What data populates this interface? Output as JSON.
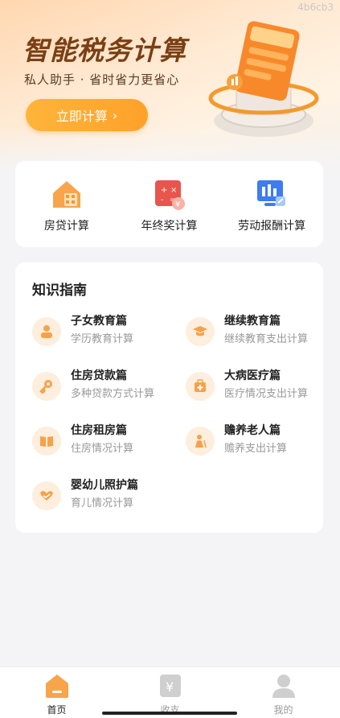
{
  "tag": "4b6cb3",
  "hero": {
    "title": "智能税务计算",
    "subtitle": "私人助手 · 省时省力更省心",
    "cta_label": "立即计算",
    "cta_arrow": "›"
  },
  "tools": [
    {
      "label": "房贷计算",
      "icon": "house-calculator-icon"
    },
    {
      "label": "年终奖计算",
      "icon": "bonus-calculator-icon"
    },
    {
      "label": "劳动报酬计算",
      "icon": "labor-pay-icon"
    }
  ],
  "guide": {
    "title": "知识指南",
    "items": [
      {
        "title": "子女教育篇",
        "sub": "学历教育计算",
        "icon": "person-icon"
      },
      {
        "title": "继续教育篇",
        "sub": "继续教育支出计算",
        "icon": "graduation-cap-icon"
      },
      {
        "title": "住房贷款篇",
        "sub": "多种贷款方式计算",
        "icon": "key-icon"
      },
      {
        "title": "大病医疗篇",
        "sub": "医疗情况支出计算",
        "icon": "medical-kit-icon"
      },
      {
        "title": "住房租房篇",
        "sub": "住房情况计算",
        "icon": "book-icon"
      },
      {
        "title": "赡养老人篇",
        "sub": "赡养支出计算",
        "icon": "elderly-icon"
      },
      {
        "title": "婴幼儿照护篇",
        "sub": "育儿情况计算",
        "icon": "heart-hand-icon"
      }
    ]
  },
  "tabbar": {
    "items": [
      {
        "label": "首页",
        "icon": "home-icon",
        "active": true
      },
      {
        "label": "收支",
        "icon": "yuan-icon",
        "active": false
      },
      {
        "label": "我的",
        "icon": "profile-icon",
        "active": false
      }
    ]
  },
  "colors": {
    "accent": "#ffa12a",
    "icon_orange": "#f5a24a",
    "icon_red": "#e8554d",
    "icon_blue": "#3e7cf0"
  }
}
